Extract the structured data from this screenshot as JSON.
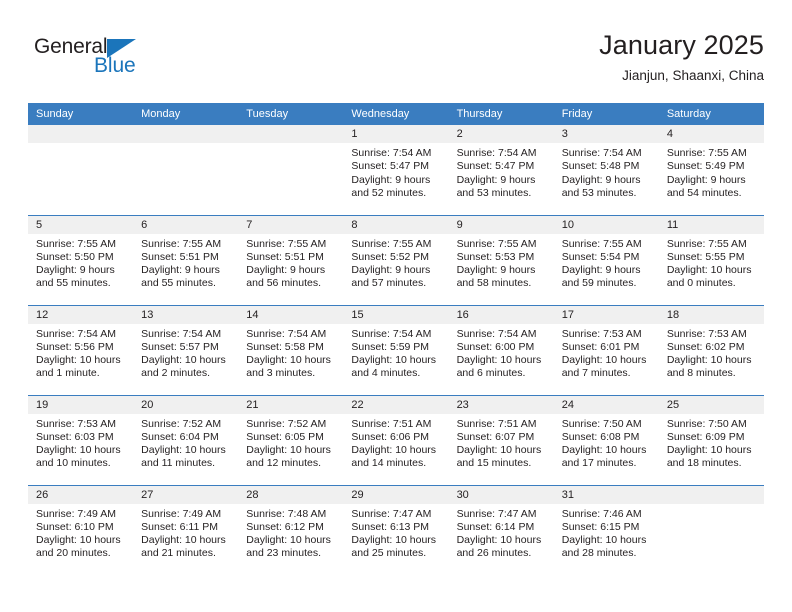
{
  "brand": {
    "name_top": "General",
    "name_bottom": "Blue",
    "accent_color": "#1b75bb"
  },
  "header": {
    "title": "January 2025",
    "subtitle": "Jianjun, Shaanxi, China"
  },
  "theme": {
    "header_row_color": "#3a7dc0",
    "daynum_bar_color": "#f0f0f0",
    "text_color": "#231f20"
  },
  "weekday_headers": [
    "Sunday",
    "Monday",
    "Tuesday",
    "Wednesday",
    "Thursday",
    "Friday",
    "Saturday"
  ],
  "weeks": [
    [
      {
        "day": "",
        "empty": true
      },
      {
        "day": "",
        "empty": true
      },
      {
        "day": "",
        "empty": true
      },
      {
        "day": "1",
        "sunrise": "Sunrise: 7:54 AM",
        "sunset": "Sunset: 5:47 PM",
        "daylight_line1": "Daylight: 9 hours",
        "daylight_line2": "and 52 minutes."
      },
      {
        "day": "2",
        "sunrise": "Sunrise: 7:54 AM",
        "sunset": "Sunset: 5:47 PM",
        "daylight_line1": "Daylight: 9 hours",
        "daylight_line2": "and 53 minutes."
      },
      {
        "day": "3",
        "sunrise": "Sunrise: 7:54 AM",
        "sunset": "Sunset: 5:48 PM",
        "daylight_line1": "Daylight: 9 hours",
        "daylight_line2": "and 53 minutes."
      },
      {
        "day": "4",
        "sunrise": "Sunrise: 7:55 AM",
        "sunset": "Sunset: 5:49 PM",
        "daylight_line1": "Daylight: 9 hours",
        "daylight_line2": "and 54 minutes."
      }
    ],
    [
      {
        "day": "5",
        "sunrise": "Sunrise: 7:55 AM",
        "sunset": "Sunset: 5:50 PM",
        "daylight_line1": "Daylight: 9 hours",
        "daylight_line2": "and 55 minutes."
      },
      {
        "day": "6",
        "sunrise": "Sunrise: 7:55 AM",
        "sunset": "Sunset: 5:51 PM",
        "daylight_line1": "Daylight: 9 hours",
        "daylight_line2": "and 55 minutes."
      },
      {
        "day": "7",
        "sunrise": "Sunrise: 7:55 AM",
        "sunset": "Sunset: 5:51 PM",
        "daylight_line1": "Daylight: 9 hours",
        "daylight_line2": "and 56 minutes."
      },
      {
        "day": "8",
        "sunrise": "Sunrise: 7:55 AM",
        "sunset": "Sunset: 5:52 PM",
        "daylight_line1": "Daylight: 9 hours",
        "daylight_line2": "and 57 minutes."
      },
      {
        "day": "9",
        "sunrise": "Sunrise: 7:55 AM",
        "sunset": "Sunset: 5:53 PM",
        "daylight_line1": "Daylight: 9 hours",
        "daylight_line2": "and 58 minutes."
      },
      {
        "day": "10",
        "sunrise": "Sunrise: 7:55 AM",
        "sunset": "Sunset: 5:54 PM",
        "daylight_line1": "Daylight: 9 hours",
        "daylight_line2": "and 59 minutes."
      },
      {
        "day": "11",
        "sunrise": "Sunrise: 7:55 AM",
        "sunset": "Sunset: 5:55 PM",
        "daylight_line1": "Daylight: 10 hours",
        "daylight_line2": "and 0 minutes."
      }
    ],
    [
      {
        "day": "12",
        "sunrise": "Sunrise: 7:54 AM",
        "sunset": "Sunset: 5:56 PM",
        "daylight_line1": "Daylight: 10 hours",
        "daylight_line2": "and 1 minute."
      },
      {
        "day": "13",
        "sunrise": "Sunrise: 7:54 AM",
        "sunset": "Sunset: 5:57 PM",
        "daylight_line1": "Daylight: 10 hours",
        "daylight_line2": "and 2 minutes."
      },
      {
        "day": "14",
        "sunrise": "Sunrise: 7:54 AM",
        "sunset": "Sunset: 5:58 PM",
        "daylight_line1": "Daylight: 10 hours",
        "daylight_line2": "and 3 minutes."
      },
      {
        "day": "15",
        "sunrise": "Sunrise: 7:54 AM",
        "sunset": "Sunset: 5:59 PM",
        "daylight_line1": "Daylight: 10 hours",
        "daylight_line2": "and 4 minutes."
      },
      {
        "day": "16",
        "sunrise": "Sunrise: 7:54 AM",
        "sunset": "Sunset: 6:00 PM",
        "daylight_line1": "Daylight: 10 hours",
        "daylight_line2": "and 6 minutes."
      },
      {
        "day": "17",
        "sunrise": "Sunrise: 7:53 AM",
        "sunset": "Sunset: 6:01 PM",
        "daylight_line1": "Daylight: 10 hours",
        "daylight_line2": "and 7 minutes."
      },
      {
        "day": "18",
        "sunrise": "Sunrise: 7:53 AM",
        "sunset": "Sunset: 6:02 PM",
        "daylight_line1": "Daylight: 10 hours",
        "daylight_line2": "and 8 minutes."
      }
    ],
    [
      {
        "day": "19",
        "sunrise": "Sunrise: 7:53 AM",
        "sunset": "Sunset: 6:03 PM",
        "daylight_line1": "Daylight: 10 hours",
        "daylight_line2": "and 10 minutes."
      },
      {
        "day": "20",
        "sunrise": "Sunrise: 7:52 AM",
        "sunset": "Sunset: 6:04 PM",
        "daylight_line1": "Daylight: 10 hours",
        "daylight_line2": "and 11 minutes."
      },
      {
        "day": "21",
        "sunrise": "Sunrise: 7:52 AM",
        "sunset": "Sunset: 6:05 PM",
        "daylight_line1": "Daylight: 10 hours",
        "daylight_line2": "and 12 minutes."
      },
      {
        "day": "22",
        "sunrise": "Sunrise: 7:51 AM",
        "sunset": "Sunset: 6:06 PM",
        "daylight_line1": "Daylight: 10 hours",
        "daylight_line2": "and 14 minutes."
      },
      {
        "day": "23",
        "sunrise": "Sunrise: 7:51 AM",
        "sunset": "Sunset: 6:07 PM",
        "daylight_line1": "Daylight: 10 hours",
        "daylight_line2": "and 15 minutes."
      },
      {
        "day": "24",
        "sunrise": "Sunrise: 7:50 AM",
        "sunset": "Sunset: 6:08 PM",
        "daylight_line1": "Daylight: 10 hours",
        "daylight_line2": "and 17 minutes."
      },
      {
        "day": "25",
        "sunrise": "Sunrise: 7:50 AM",
        "sunset": "Sunset: 6:09 PM",
        "daylight_line1": "Daylight: 10 hours",
        "daylight_line2": "and 18 minutes."
      }
    ],
    [
      {
        "day": "26",
        "sunrise": "Sunrise: 7:49 AM",
        "sunset": "Sunset: 6:10 PM",
        "daylight_line1": "Daylight: 10 hours",
        "daylight_line2": "and 20 minutes."
      },
      {
        "day": "27",
        "sunrise": "Sunrise: 7:49 AM",
        "sunset": "Sunset: 6:11 PM",
        "daylight_line1": "Daylight: 10 hours",
        "daylight_line2": "and 21 minutes."
      },
      {
        "day": "28",
        "sunrise": "Sunrise: 7:48 AM",
        "sunset": "Sunset: 6:12 PM",
        "daylight_line1": "Daylight: 10 hours",
        "daylight_line2": "and 23 minutes."
      },
      {
        "day": "29",
        "sunrise": "Sunrise: 7:47 AM",
        "sunset": "Sunset: 6:13 PM",
        "daylight_line1": "Daylight: 10 hours",
        "daylight_line2": "and 25 minutes."
      },
      {
        "day": "30",
        "sunrise": "Sunrise: 7:47 AM",
        "sunset": "Sunset: 6:14 PM",
        "daylight_line1": "Daylight: 10 hours",
        "daylight_line2": "and 26 minutes."
      },
      {
        "day": "31",
        "sunrise": "Sunrise: 7:46 AM",
        "sunset": "Sunset: 6:15 PM",
        "daylight_line1": "Daylight: 10 hours",
        "daylight_line2": "and 28 minutes."
      },
      {
        "day": "",
        "empty": true
      }
    ]
  ]
}
